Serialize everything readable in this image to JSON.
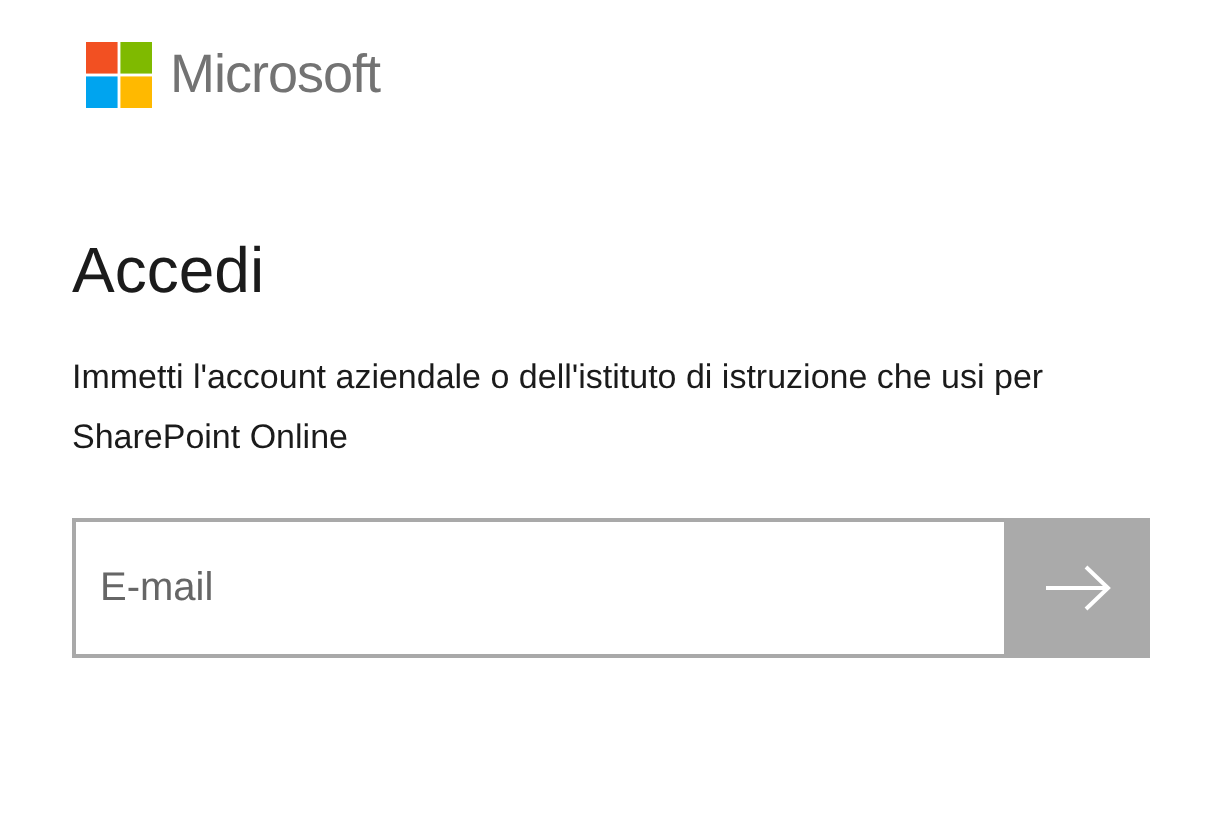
{
  "brand": {
    "name": "Microsoft"
  },
  "heading": "Accedi",
  "description": "Immetti l'account aziendale o dell'istituto di istruzione che usi per SharePoint Online",
  "email_field": {
    "placeholder": "E-mail"
  },
  "submit": {
    "disabled": true
  }
}
